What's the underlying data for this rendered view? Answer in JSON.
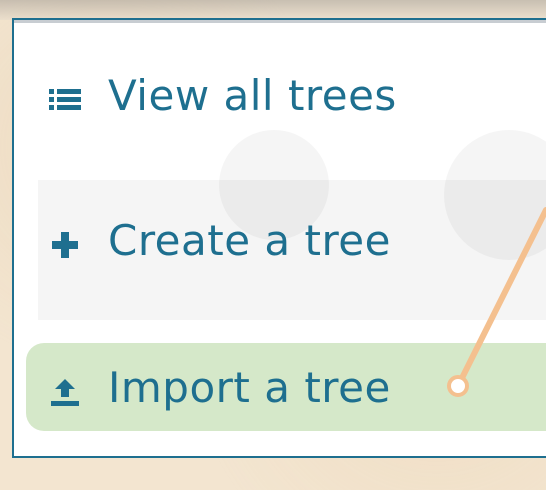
{
  "menu": {
    "items": [
      {
        "label": "View all trees",
        "icon": "list-icon"
      },
      {
        "label": "Create a tree",
        "icon": "plus-icon"
      },
      {
        "label": "Import a tree",
        "icon": "upload-icon",
        "highlighted": true
      }
    ]
  },
  "colors": {
    "accent": "#1e6f8f",
    "highlight_bg": "#d5e8c9",
    "pointer": "#f4c08f",
    "background": "#f3e5d0"
  }
}
